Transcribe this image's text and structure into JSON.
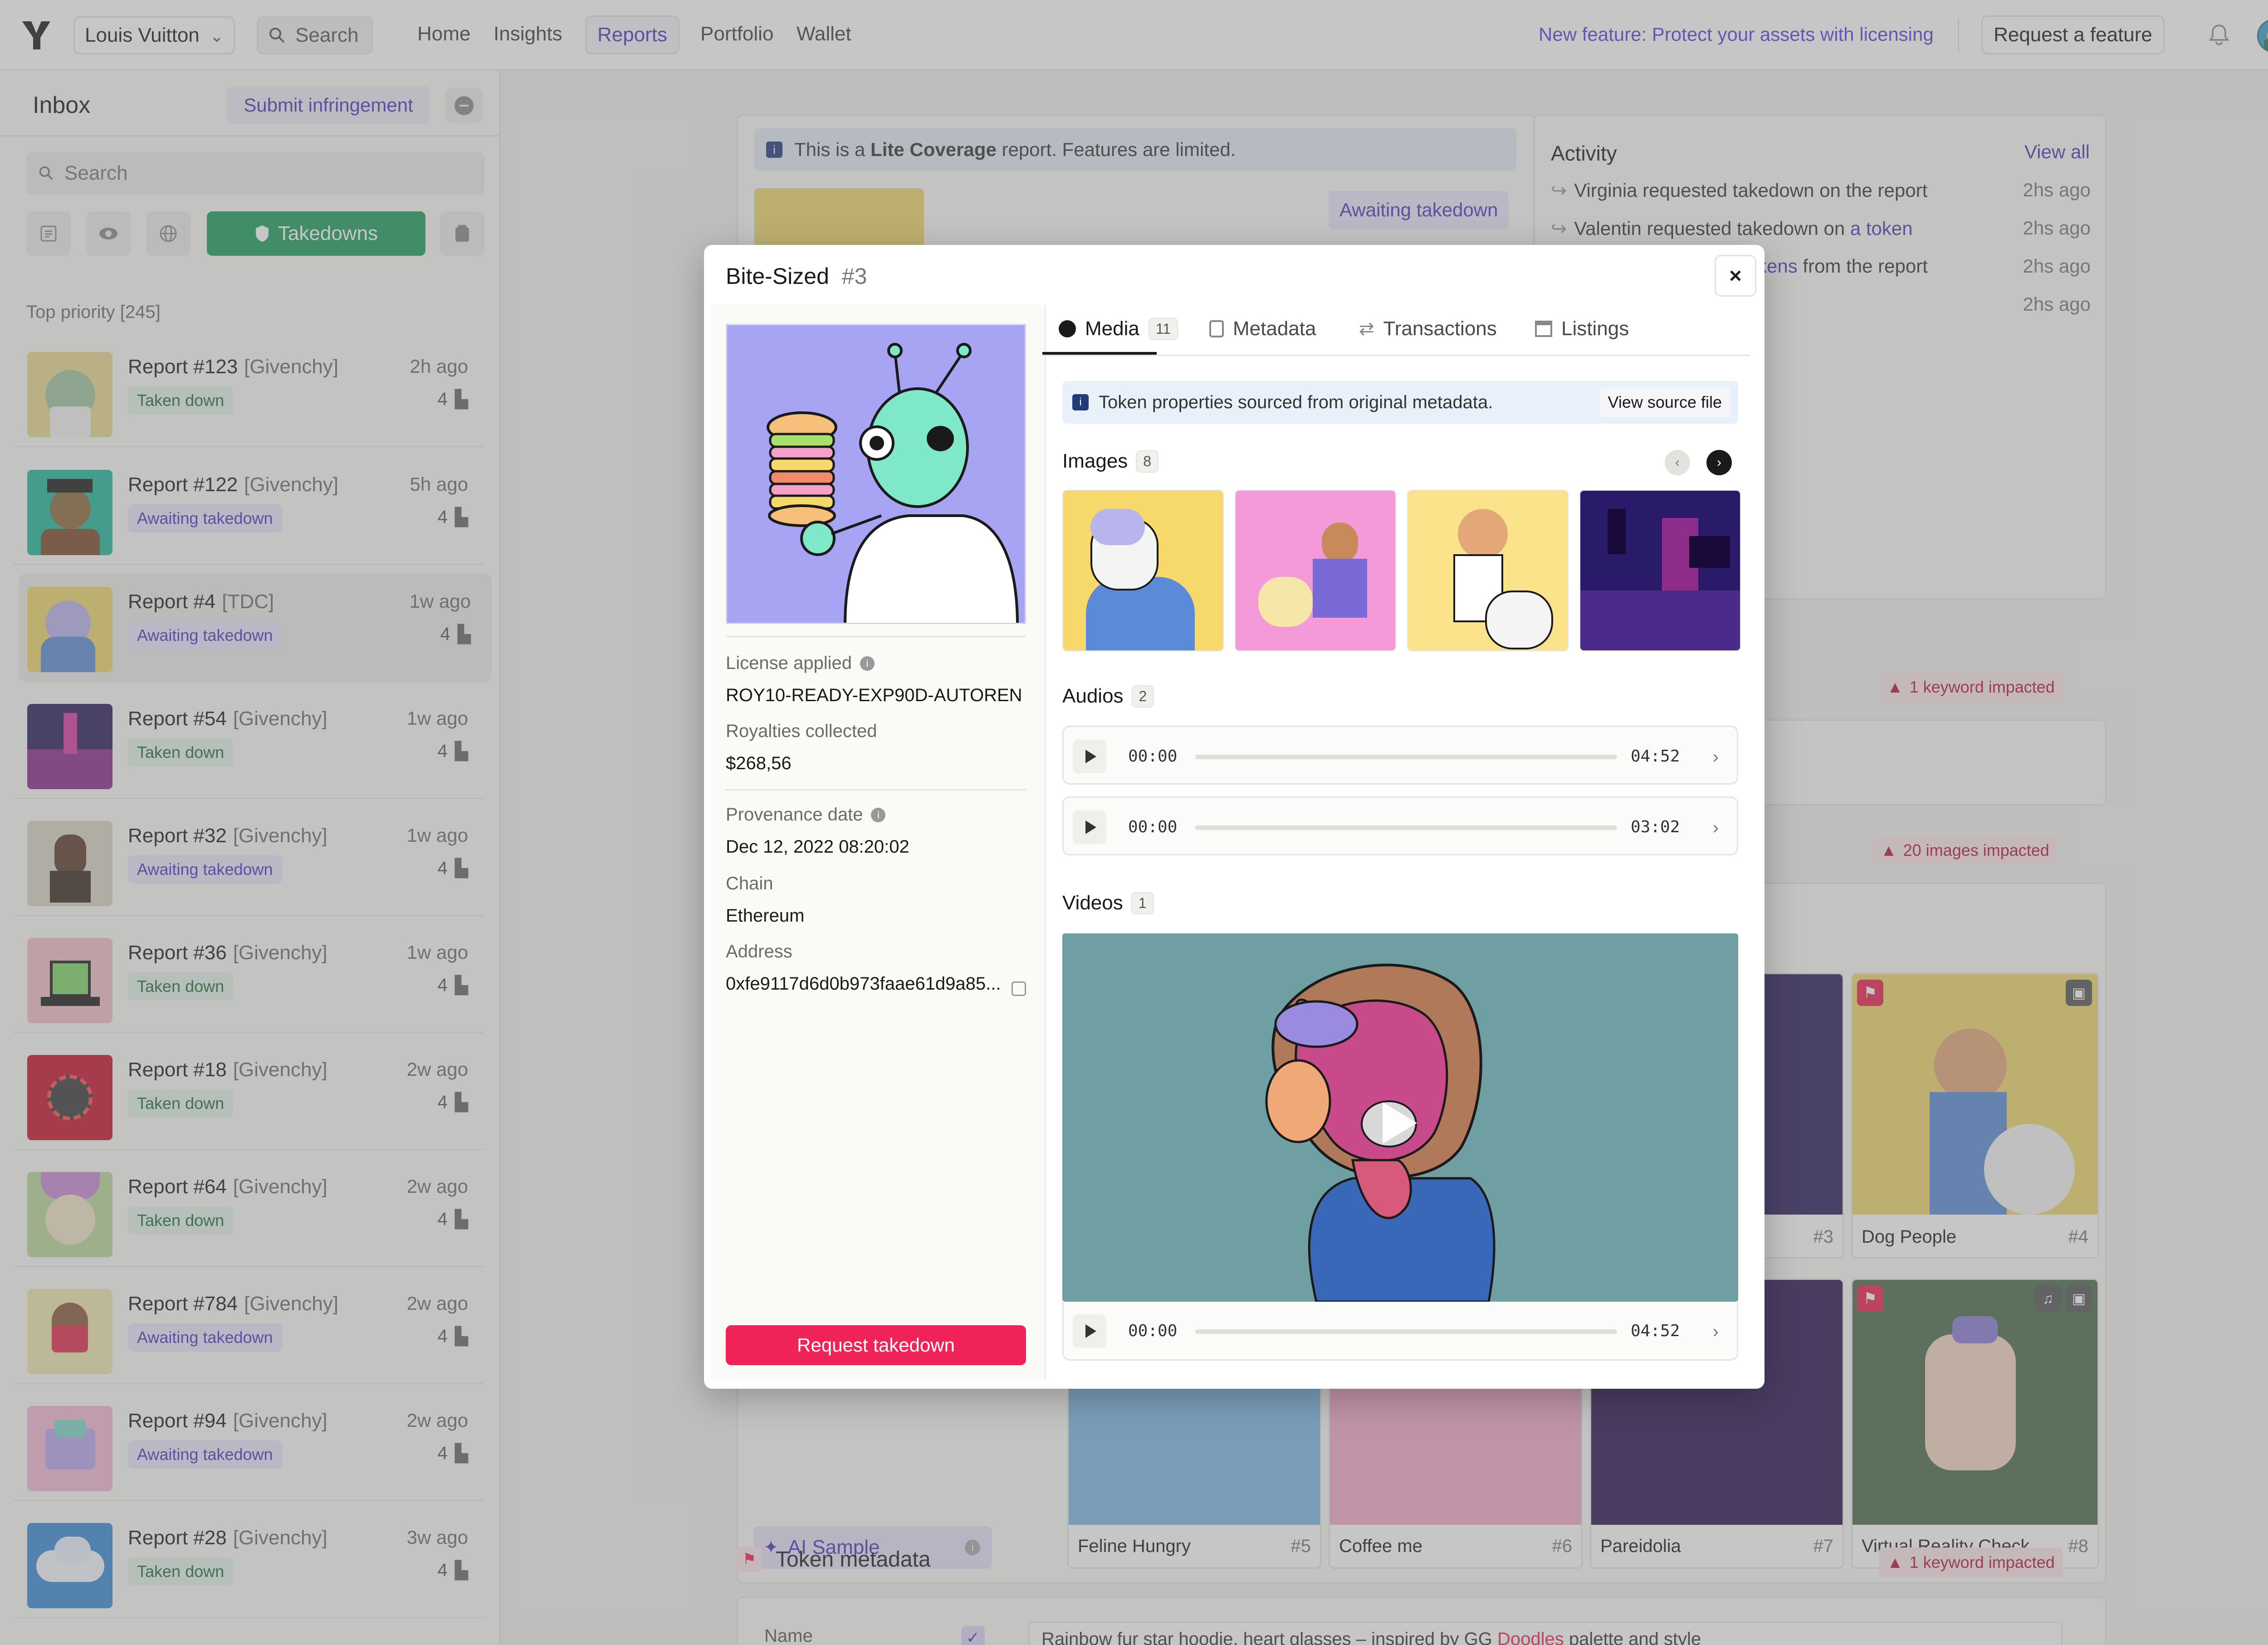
{
  "nav": {
    "brand": "Louis Vuitton",
    "search_label": "Search",
    "links": [
      "Home",
      "Insights",
      "Reports",
      "Portfolio",
      "Wallet"
    ],
    "promo": "New feature: Protect your assets with licensing",
    "request_feature": "Request a feature"
  },
  "sidebar": {
    "title": "Inbox",
    "submit": "Submit infringement",
    "search_placeholder": "Search",
    "takedowns": "Takedowns",
    "section": "Top priority [245]",
    "reports": [
      {
        "title": "Report #123",
        "org": "[Givenchy]",
        "time": "2h ago",
        "status": "Taken down",
        "count": "4"
      },
      {
        "title": "Report #122",
        "org": "[Givenchy]",
        "time": "5h ago",
        "status": "Awaiting takedown",
        "count": "4"
      },
      {
        "title": "Report #4",
        "org": "[TDC]",
        "time": "1w ago",
        "status": "Awaiting takedown",
        "count": "4"
      },
      {
        "title": "Report #54",
        "org": "[Givenchy]",
        "time": "1w ago",
        "status": "Taken down",
        "count": "4"
      },
      {
        "title": "Report #32",
        "org": "[Givenchy]",
        "time": "1w ago",
        "status": "Awaiting takedown",
        "count": "4"
      },
      {
        "title": "Report #36",
        "org": "[Givenchy]",
        "time": "1w ago",
        "status": "Taken down",
        "count": "4"
      },
      {
        "title": "Report #18",
        "org": "[Givenchy]",
        "time": "2w ago",
        "status": "Taken down",
        "count": "4"
      },
      {
        "title": "Report #64",
        "org": "[Givenchy]",
        "time": "2w ago",
        "status": "Taken down",
        "count": "4"
      },
      {
        "title": "Report #784",
        "org": "[Givenchy]",
        "time": "2w ago",
        "status": "Awaiting takedown",
        "count": "4"
      },
      {
        "title": "Report #94",
        "org": "[Givenchy]",
        "time": "2w ago",
        "status": "Awaiting takedown",
        "count": "4"
      },
      {
        "title": "Report #28",
        "org": "[Givenchy]",
        "time": "3w ago",
        "status": "Taken down",
        "count": "4"
      }
    ]
  },
  "background": {
    "notice_prefix": "This is a ",
    "notice_bold": "Lite Coverage",
    "notice_suffix": " report. Features are limited.",
    "awaiting": "Awaiting takedown",
    "activity_title": "Activity",
    "view_all": "View all",
    "activity": [
      {
        "text": "Virginia requested takedown on the report",
        "time": "2hs ago"
      },
      {
        "text": "Valentin requested takedown on",
        "link": "a token",
        "time": "2hs ago"
      },
      {
        "text": "from the report",
        "link": "tokens",
        "time": "2hs ago"
      },
      {
        "text": "",
        "time": "2hs ago"
      }
    ],
    "keyword_impacted": "1 keyword impacted",
    "images_impacted": "20 images impacted",
    "ai_sample": "AI Sample",
    "token_metadata": "Token metadata",
    "name_label": "Name",
    "desc_text": "Rainbow fur star hoodie, heart glasses – inspired by GG",
    "desc_link": "Doodles",
    "desc_tail": "palette and style",
    "cards": [
      {
        "name": "Dog People",
        "num": "#4"
      },
      {
        "name": "Feline Hungry",
        "num": "#5"
      },
      {
        "name": "Coffee me",
        "num": "#6"
      },
      {
        "name": "Pareidolia",
        "num": "#7"
      },
      {
        "name": "Virtual Reality Check",
        "num": "#8"
      },
      {
        "name": "",
        "num": "#3"
      }
    ]
  },
  "modal": {
    "title": "Bite-Sized",
    "num": "#3",
    "license_label": "License applied",
    "license_value": "ROY10-READY-EXP90D-AUTOREN",
    "royalties_label": "Royalties collected",
    "royalties_value": "$268,56",
    "provenance_label": "Provenance date",
    "provenance_value": "Dec 12, 2022 08:20:02",
    "chain_label": "Chain",
    "chain_value": "Ethereum",
    "address_label": "Address",
    "address_value": "0xfe9117d6d0b973faae61d9a85...",
    "request_takedown": "Request takedown",
    "tabs": [
      {
        "label": "Media",
        "count": "11"
      },
      {
        "label": "Metadata"
      },
      {
        "label": "Transactions"
      },
      {
        "label": "Listings"
      }
    ],
    "source_notice": "Token properties sourced from original metadata.",
    "view_source": "View source file",
    "images_label": "Images",
    "images_count": "8",
    "audios_label": "Audios",
    "audios_count": "2",
    "videos_label": "Videos",
    "videos_count": "1",
    "audios": [
      {
        "current": "00:00",
        "total": "04:52"
      },
      {
        "current": "00:00",
        "total": "03:02"
      }
    ],
    "video_audio": {
      "current": "00:00",
      "total": "04:52"
    }
  },
  "colors": {
    "accent": "#4b36b8",
    "green": "#1a9e5c",
    "red": "#e8214e"
  }
}
